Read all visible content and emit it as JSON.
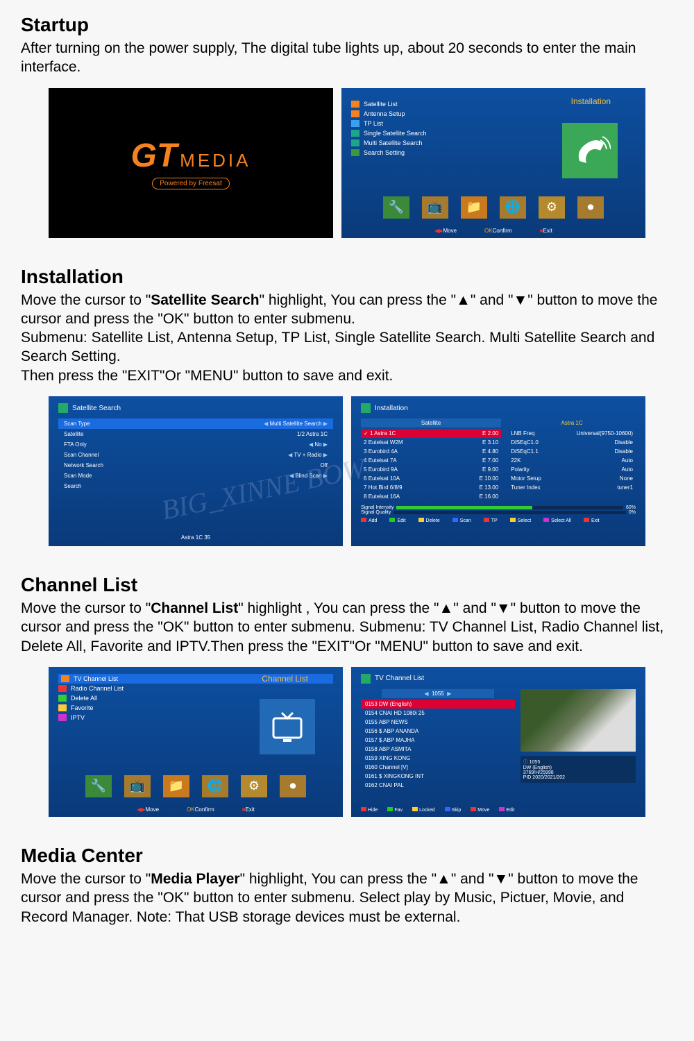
{
  "startup": {
    "title": "Startup",
    "body": "After turning on the power supply, The digital tube lights up, about 20 seconds to enter the main interface.",
    "logo": {
      "gt": "GT",
      "media": "MEDIA",
      "sub": "Powered by Freesat"
    },
    "inst_header": "Installation",
    "menu": [
      "Satellite List",
      "Antenna Setup",
      "TP List",
      "Single Satellite Search",
      "Multi Satellite Search",
      "Search Setting"
    ],
    "hints": {
      "move": "Move",
      "confirm": "Confirm",
      "exit": "Exit"
    }
  },
  "installation": {
    "title": "Installation",
    "body1a": "Move the cursor to \"",
    "body1b": "Satellite Search",
    "body1c": "\" highlight, You can press the \"▲\" and \"▼\" button to move the cursor and press the \"OK\" button to enter submenu.",
    "body2": "Submenu: Satellite List, Antenna Setup, TP List, Single Satellite Search. Multi Satellite Search and Search Setting.",
    "body3": "Then press the \"EXIT\"Or \"MENU\"  button to save and exit.",
    "left": {
      "title": "Satellite Search",
      "rows": [
        {
          "k": "Scan Type",
          "v": "Multi Satellite Search",
          "hl": true
        },
        {
          "k": "Satellite",
          "v": "1/2 Astra 1C"
        },
        {
          "k": "FTA Only",
          "v": "No"
        },
        {
          "k": "Scan Channel",
          "v": "TV + Radio"
        },
        {
          "k": "Network Search",
          "v": "Off"
        },
        {
          "k": "Scan Mode",
          "v": "Blind Scan"
        },
        {
          "k": "Search",
          "v": ""
        }
      ],
      "footer": "Astra 1C 35"
    },
    "right": {
      "title": "Installation",
      "header": "Satellite",
      "sats": [
        {
          "n": "1",
          "name": "Astra 1C",
          "e": "E  2.00",
          "sel": true
        },
        {
          "n": "2",
          "name": "Eutelsat W2M",
          "e": "E  3.10"
        },
        {
          "n": "3",
          "name": "Eurobird 4A",
          "e": "E  4.80"
        },
        {
          "n": "4",
          "name": "Eutelsat 7A",
          "e": "E  7.00"
        },
        {
          "n": "5",
          "name": "Eurobird 9A",
          "e": "E  9.00"
        },
        {
          "n": "6",
          "name": "Eutelsat 10A",
          "e": "E  10.00"
        },
        {
          "n": "7",
          "name": "Hot Bird 6/8/9",
          "e": "E  13.00"
        },
        {
          "n": "8",
          "name": "Eutelsat 16A",
          "e": "E  16.00"
        }
      ],
      "props_title": "Astra 1C",
      "props": [
        {
          "k": "LNB Freq",
          "v": "Universal(9750-10600)"
        },
        {
          "k": "DiSEqC1.0",
          "v": "Disable"
        },
        {
          "k": "DiSEqC1.1",
          "v": "Disable"
        },
        {
          "k": "22K",
          "v": "Auto"
        },
        {
          "k": "Polarity",
          "v": "Auto"
        },
        {
          "k": "Motor Setup",
          "v": "None"
        },
        {
          "k": "Tuner Index",
          "v": "tuner1"
        }
      ],
      "signal_intensity": {
        "label": "Signal Intensity",
        "pct": "60%",
        "val": 60
      },
      "signal_quality": {
        "label": "Signal Quality",
        "pct": "0%",
        "val": 0
      },
      "legend": [
        "Add",
        "Edit",
        "Delete",
        "Scan",
        "TP",
        "Select",
        "Select All",
        "Exit"
      ]
    }
  },
  "channel": {
    "title": "Channel List",
    "body1a": "Move the cursor to \"",
    "body1b": "Channel List",
    "body1c": "\" highlight , You can press the \"▲\" and \"▼\" button to move the cursor and press the \"OK\" button to enter submenu.  Submenu: TV Channel List, Radio Channel list, Delete All, Favorite and IPTV.Then press the \"EXIT\"Or \"MENU\"  button to save and exit.",
    "left": {
      "header": "Channel List",
      "menu": [
        "TV Channel List",
        "Radio Channel List",
        "Delete All",
        "Favorite",
        "IPTV"
      ],
      "hints": {
        "move": "Move",
        "confirm": "Confirm",
        "exit": "Exit"
      }
    },
    "right": {
      "title": "TV Channel List",
      "num": "1055",
      "channels": [
        {
          "t": "0153  DW (English)",
          "sel": true
        },
        {
          "t": "0154  CNAI HD 1080i 25"
        },
        {
          "t": "0155  ABP NEWS"
        },
        {
          "t": "0156  $ ABP ANANDA"
        },
        {
          "t": "0157  $ ABP MAJHA"
        },
        {
          "t": "0158  ABP ASMITA"
        },
        {
          "t": "0159  XING KONG"
        },
        {
          "t": "0160  Channel [V]"
        },
        {
          "t": "0161  $ XINGKONG INT"
        },
        {
          "t": "0162  CNAI PAL"
        }
      ],
      "info": {
        "num": "1055",
        "name": "DW (English)",
        "line3": "3769/H/25998",
        "line4": "PID 2020/2021/202"
      },
      "legend": [
        "Hide",
        "Fav",
        "Locked",
        "Skip",
        "Move",
        "Edit"
      ]
    }
  },
  "media": {
    "title": "Media Center",
    "body1a": "Move the cursor to \"",
    "body1b": "Media Player",
    "body1c": "\" highlight, You can press the \"▲\" and \"▼\" button  to move the cursor and press the \"OK\" button to enter submenu. Select play by Music, Pictuer, Movie, and Record Manager. Note: That USB storage devices must be external."
  },
  "watermark": "BIG_XINNE BOW"
}
